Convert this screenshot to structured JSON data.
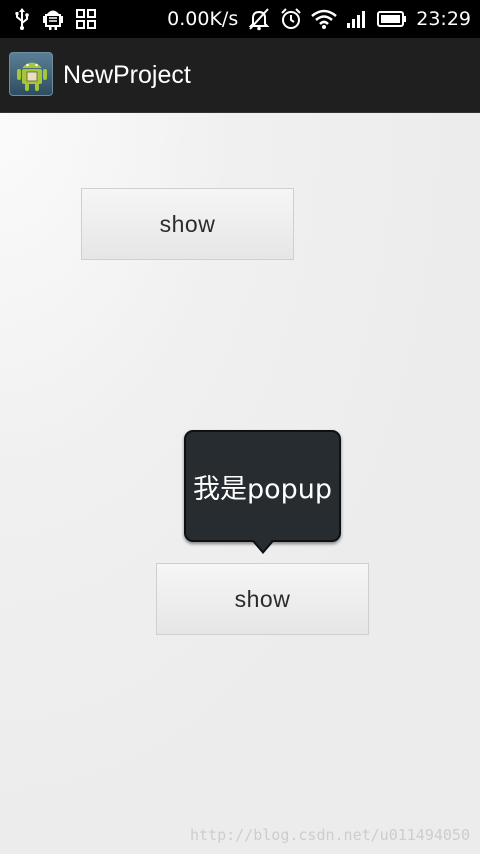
{
  "status_bar": {
    "left_icons": [
      "usb-icon",
      "android-debug-icon",
      "grid-icon"
    ],
    "network_speed": "0.00K/s",
    "right_icons": [
      "notifications-off-icon",
      "alarm-icon",
      "wifi-icon",
      "signal-icon",
      "battery-icon"
    ],
    "time": "23:29"
  },
  "action_bar": {
    "app_icon": "android-app-icon",
    "title": "NewProject"
  },
  "content": {
    "button_top_label": "show",
    "popup_text": "我是popup",
    "button_bottom_label": "show"
  },
  "watermark": {
    "text": "http://blog.csdn.net/u011494050"
  }
}
